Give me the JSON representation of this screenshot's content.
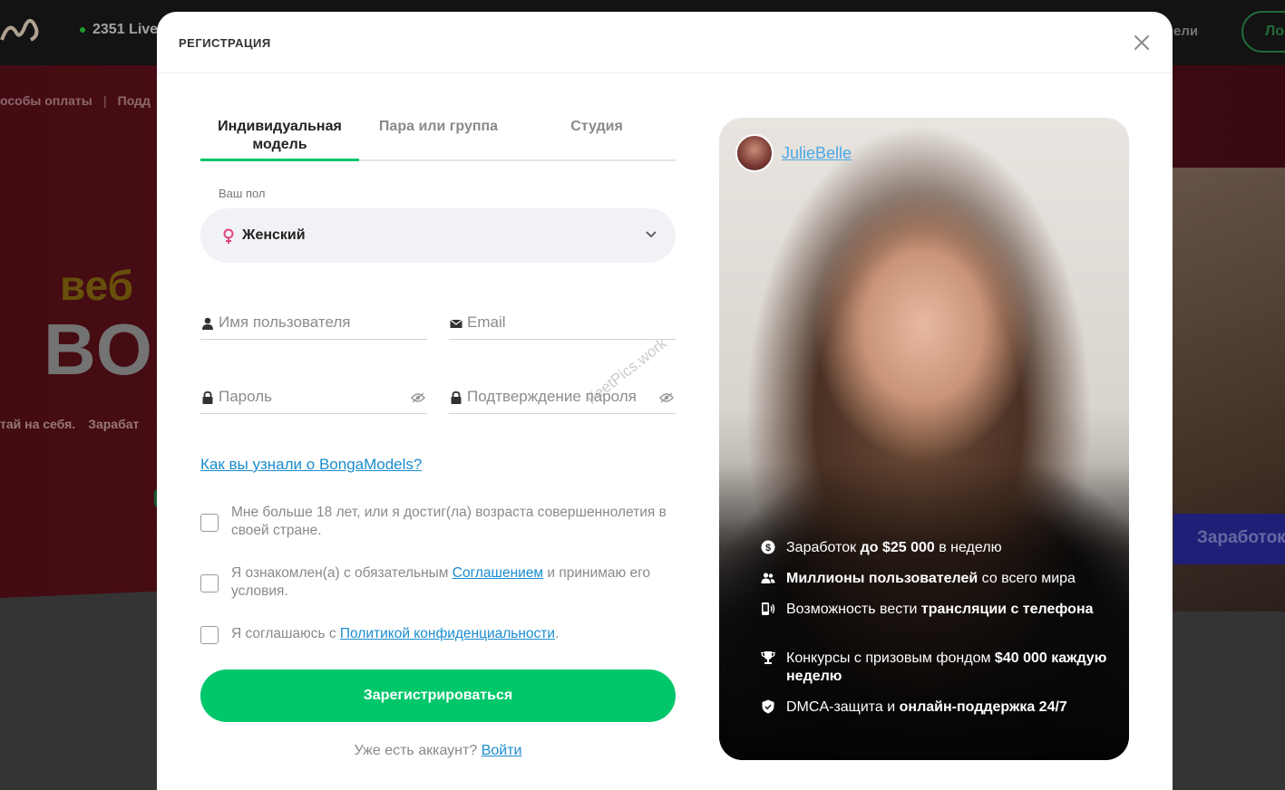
{
  "background": {
    "logo_text": "",
    "live_count": "2351 Live",
    "header_right_link": "ели",
    "login_button": "Ло",
    "nav_items": [
      "особы оплаты",
      "Подд"
    ],
    "hero_line1": "веб",
    "hero_line2": "BO",
    "hero_sub": [
      "тай на себя.",
      "Зарабат"
    ],
    "earn_button": "Заработок"
  },
  "modal": {
    "title": "РЕГИСТРАЦИЯ",
    "tabs": [
      {
        "label": "Индивидуальная модель",
        "active": true
      },
      {
        "label": "Пара или группа",
        "active": false
      },
      {
        "label": "Студия",
        "active": false
      }
    ],
    "gender": {
      "label": "Ваш пол",
      "value": "Женский"
    },
    "fields": {
      "username_placeholder": "Имя пользователя",
      "email_placeholder": "Email",
      "password_placeholder": "Пароль",
      "confirm_placeholder": "Подтверждение пароля"
    },
    "how_link": "Как вы узнали о BongaModels?",
    "checkboxes": {
      "age": "Мне больше 18 лет, или я достиг(ла) возраста совершеннолетия в своей стране.",
      "agreement_pre": "Я ознакомлен(а) с обязательным ",
      "agreement_link": "Соглашением",
      "agreement_post": " и принимаю его условия.",
      "privacy_pre": "Я соглашаюсь с ",
      "privacy_link": "Политикой конфиденциальности",
      "privacy_post": "."
    },
    "register_button": "Зарегистрироваться",
    "have_account": "Уже есть аккаунт?",
    "login_link": "Войти",
    "watermark": "FeetPics.work"
  },
  "promo": {
    "model_name": "JulieBelle",
    "features": [
      {
        "icon": "dollar-icon",
        "pre": "Заработок ",
        "bold": "до $25 000",
        "post": " в неделю"
      },
      {
        "icon": "users-icon",
        "pre": "",
        "bold": "Миллионы пользователей",
        "post": " со всего мира"
      },
      {
        "icon": "phone-broadcast-icon",
        "pre": "Возможность вести ",
        "bold": "трансляции с телефона",
        "post": ""
      },
      {
        "icon": "trophy-icon",
        "pre": "Конкурсы с призовым фондом ",
        "bold": "$40 000 каждую неделю",
        "post": ""
      },
      {
        "icon": "shield-check-icon",
        "pre": "DMCA-защита и ",
        "bold": "онлайн-поддержка 24/7",
        "post": ""
      }
    ]
  },
  "colors": {
    "accent_green": "#00c76a",
    "link_blue": "#1a8ccf",
    "female_pink": "#e0457b"
  }
}
